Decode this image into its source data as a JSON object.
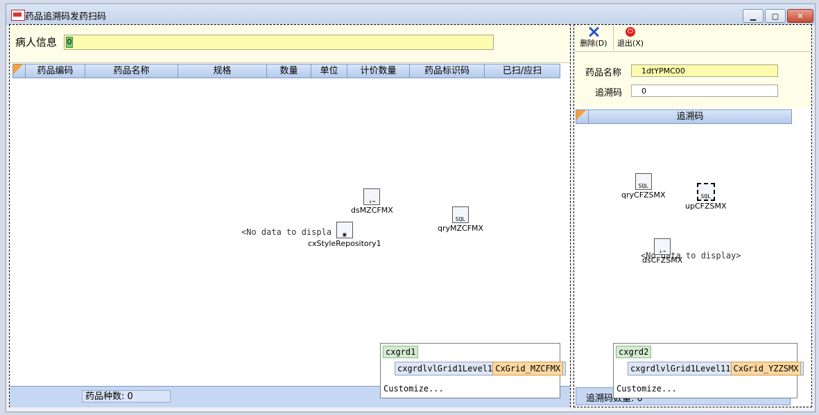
{
  "window": {
    "title": "药品追溯码发药扫码"
  },
  "left": {
    "patient_label": "病人信息",
    "patient_value": "0",
    "columns": [
      "药品编码",
      "药品名称",
      "规格",
      "数量",
      "单位",
      "计价数量",
      "药品标识码",
      "已扫/应扫"
    ],
    "no_data": "<No data to displa",
    "components": {
      "ds": "dsMZCFMX",
      "qry": "qryMZCFMX",
      "style": "cxStyleRepository1"
    },
    "footer_text": "药品种数: 0",
    "popup": {
      "grid": "cxgrd1",
      "level": "cxgrdlvlGrid1Level1",
      "view": "CxGrid_MZCFMX",
      "customize": "Customize..."
    }
  },
  "right": {
    "toolbar": {
      "delete": "删除(D)",
      "exit": "退出(X)"
    },
    "drug_name_label": "药品名称",
    "drug_name_value": "1dtYPMC00",
    "trace_label": "追溯码",
    "trace_value": "0",
    "column": "追溯码",
    "no_data": "<No data to display>",
    "components": {
      "qry": "qryCFZSMX",
      "up": "upCFZSMX",
      "ds": "dsCFZSMX"
    },
    "footer_text": "追溯码数量: 0",
    "popup": {
      "grid": "cxgrd2",
      "level": "cxgrdlvlGrid1Level11",
      "view": "CxGrid_YZZSMX",
      "customize": "Customize..."
    }
  }
}
